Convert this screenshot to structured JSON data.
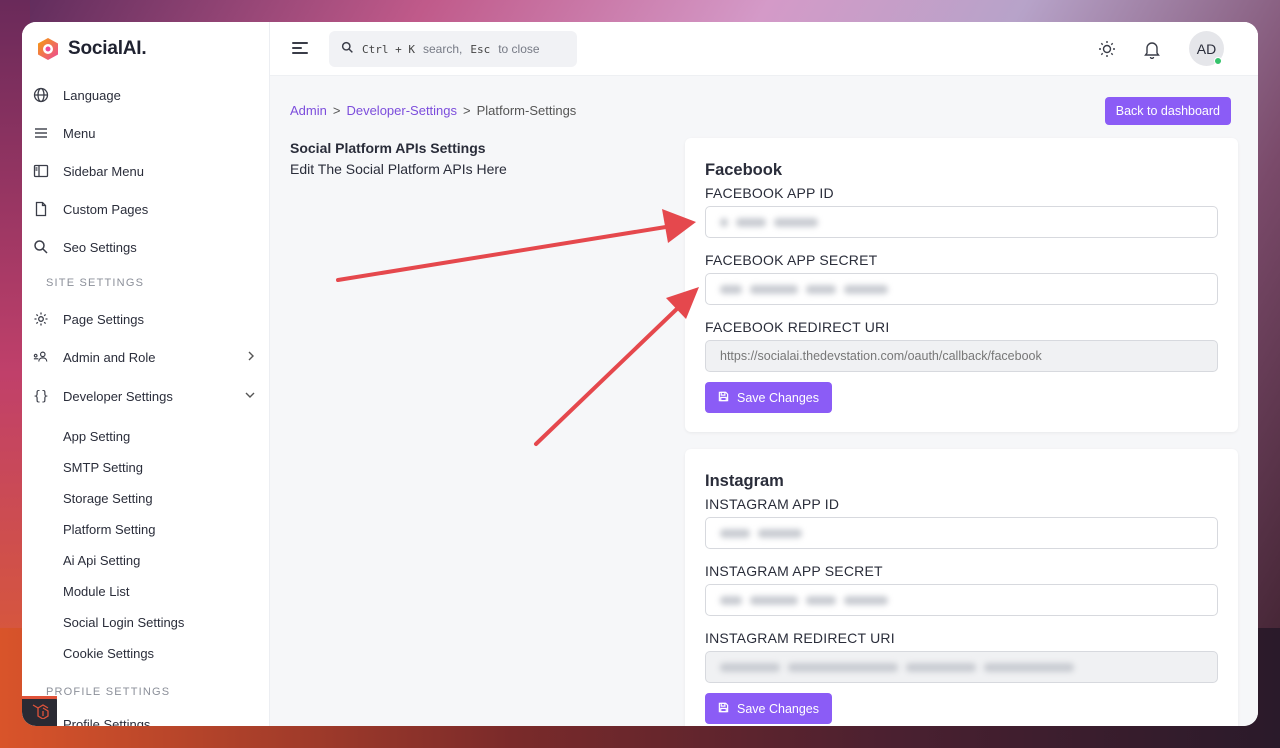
{
  "brand": {
    "name": "SocialAI."
  },
  "sidebar": {
    "items": [
      {
        "label": "Language",
        "icon": "globe-icon"
      },
      {
        "label": "Menu",
        "icon": "menu-icon"
      },
      {
        "label": "Sidebar Menu",
        "icon": "sidebar-icon"
      },
      {
        "label": "Custom Pages",
        "icon": "file-icon"
      },
      {
        "label": "Seo Settings",
        "icon": "search-icon"
      }
    ],
    "site_settings_label": "SITE SETTINGS",
    "site_items": [
      {
        "label": "Page Settings",
        "icon": "gear-icon"
      },
      {
        "label": "Admin and Role",
        "icon": "users-icon"
      },
      {
        "label": "Developer Settings",
        "icon": "code-braces-icon"
      }
    ],
    "developer_sub_items": [
      "App Setting",
      "SMTP Setting",
      "Storage Setting",
      "Platform Setting",
      "Ai Api Setting",
      "Module List",
      "Social Login Settings",
      "Cookie Settings"
    ],
    "profile_settings_label": "PROFILE SETTINGS",
    "profile_items": [
      {
        "label": "Profile Settings"
      }
    ]
  },
  "topbar": {
    "search_kbd1": "Ctrl + K",
    "search_text1": "search,",
    "search_kbd2": "Esc",
    "search_text2": "to close",
    "avatar_initials": "AD"
  },
  "breadcrumb": {
    "items": [
      "Admin",
      "Developer-Settings",
      "Platform-Settings"
    ],
    "separator": ">"
  },
  "back_button": "Back to dashboard",
  "intro": {
    "title": "Social Platform APIs Settings",
    "subtitle": "Edit The Social Platform APIs Here"
  },
  "facebook": {
    "title": "Facebook",
    "app_id_label": "FACEBOOK APP ID",
    "app_secret_label": "FACEBOOK APP SECRET",
    "redirect_label": "FACEBOOK REDIRECT URI",
    "redirect_value": "https://socialai.thedevstation.com/oauth/callback/facebook",
    "save_label": "Save Changes"
  },
  "instagram": {
    "title": "Instagram",
    "app_id_label": "INSTAGRAM APP ID",
    "app_secret_label": "INSTAGRAM APP SECRET",
    "redirect_label": "INSTAGRAM REDIRECT URI",
    "save_label": "Save Changes"
  },
  "colors": {
    "accent": "#8b5cf6",
    "annotation_arrow": "#e5484d",
    "online_dot": "#35c36b"
  }
}
